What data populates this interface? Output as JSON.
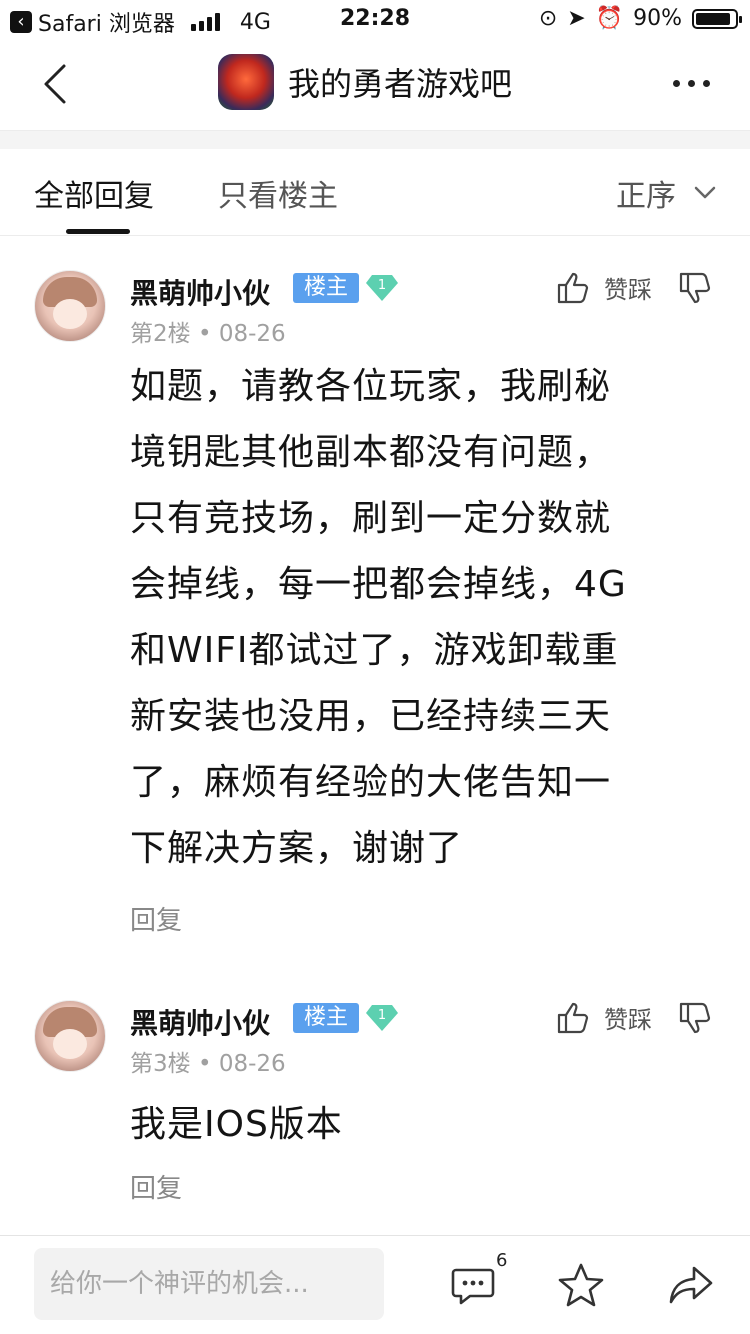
{
  "status_bar": {
    "app": "Safari 浏览器",
    "network": "4G",
    "time": "22:28",
    "battery": "90%",
    "battery_level": 0.9
  },
  "nav": {
    "title": "我的勇者游戏吧"
  },
  "tabs": {
    "all": "全部回复",
    "owner_only": "只看楼主",
    "sort": "正序"
  },
  "posts": [
    {
      "username": "黑萌帅小伙",
      "badge": "楼主",
      "level": "1",
      "floor": "第2楼",
      "date": "08-26",
      "vote_label": "赞踩",
      "content_lines": [
        "如题，请教各位玩家，我刷秘",
        "境钥匙其他副本都没有问题，",
        "只有竞技场，刷到一定分数就",
        "会掉线，每一把都会掉线，4G",
        "和WIFI都试过了，游戏卸载重",
        "新安装也没用，已经持续三天",
        "了，麻烦有经验的大佬告知一",
        "下解决方案，谢谢了"
      ],
      "reply": "回复"
    },
    {
      "username": "黑萌帅小伙",
      "badge": "楼主",
      "level": "1",
      "floor": "第3楼",
      "date": "08-26",
      "vote_label": "赞踩",
      "content_lines": [
        "我是IOS版本"
      ],
      "reply": "回复"
    }
  ],
  "bottom_bar": {
    "placeholder": "给你一个神评的机会...",
    "comment_count": "6"
  },
  "colors": {
    "owner_badge": "#5aa0ee",
    "level_badge": "#5cd0b0"
  }
}
